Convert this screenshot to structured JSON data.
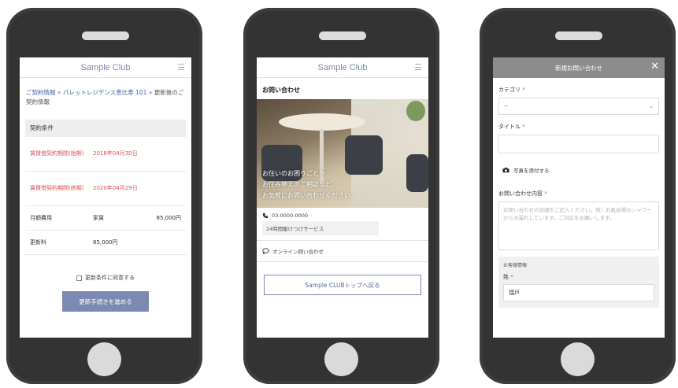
{
  "screen1": {
    "app_title": "Sample Club",
    "breadcrumb": {
      "link_text": "ご契約情報 » パレットレジデンス恵比寿 101 »",
      "current": "更新後のご契約情報"
    },
    "section_title": "契約条件",
    "rows": [
      {
        "label": "賃貸借契約期間(始期)",
        "value": "2018年04月30日",
        "extra": ""
      },
      {
        "label": "賃貸借契約期間(終期)",
        "value": "2020年04月29日",
        "extra": ""
      },
      {
        "label": "月額費用",
        "value": "家賃",
        "extra": "85,000円"
      },
      {
        "label": "更新料",
        "value": "85,000円",
        "extra": ""
      }
    ],
    "agree_label": "更新条件に同意する",
    "proceed_label": "更新手続きを進める"
  },
  "screen2": {
    "app_title": "Sample Club",
    "page_title": "お問い合わせ",
    "hero_lines": [
      "お住いのお困りごとや",
      "お住み替えのご相談など、",
      "お気軽にお問い合わせください。"
    ],
    "phone_number": "03-0000-0000",
    "service_text": "24時間駆けつけサービス",
    "online_label": "オンライン問い合わせ",
    "back_label": "Sample CLUBトップへ戻る"
  },
  "screen3": {
    "modal_title": "新規お問い合わせ",
    "close_symbol": "✕",
    "category_label": "カテゴリ",
    "category_value": "--",
    "title_label": "タイトル",
    "required_mark": "*",
    "photo_label": "写真を添付する",
    "content_label": "お問い合わせ内容",
    "content_placeholder": "お問い合わせの詳細をご記入ください。例）お風呂場のシャワーから水漏れしています。ご対応をお願いします。",
    "customer_section": "お客様情報",
    "surname_label": "姓",
    "surname_value": "瑞戸"
  },
  "colors": {
    "accent": "#7c89b0",
    "required": "#d9534f",
    "link": "#3f5ea8"
  },
  "icons": [
    "menu-icon",
    "phone-icon",
    "chat-bubble-icon",
    "camera-icon",
    "close-icon",
    "chevron-down-icon"
  ]
}
